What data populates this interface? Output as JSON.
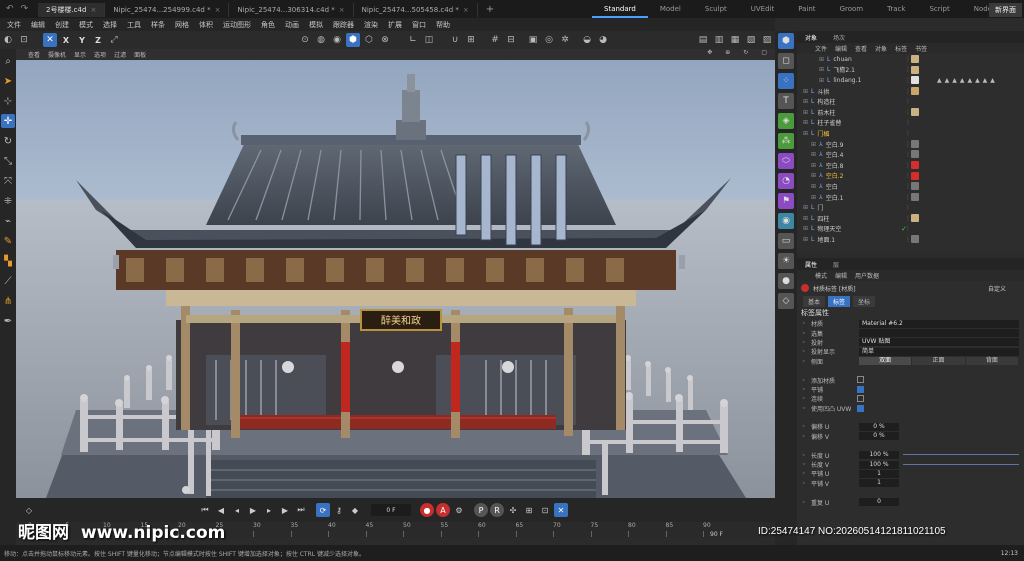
{
  "titlebar": {
    "tabs": [
      {
        "label": "2号楼楼.c4d",
        "active": true
      },
      {
        "label": "Nipic_25474...254999.c4d *",
        "active": false
      },
      {
        "label": "Nipic_25474...306314.c4d *",
        "active": false
      },
      {
        "label": "Nipic_25474...505458.c4d *",
        "active": false
      }
    ],
    "add_tab": "+",
    "layouts": [
      "Standard",
      "Model",
      "Sculpt",
      "UVEdit",
      "Paint",
      "Groom",
      "Track",
      "Script",
      "Nodes"
    ],
    "active_layout": "Standard",
    "new_layout": "新界面"
  },
  "menubar": {
    "items": [
      "文件",
      "编辑",
      "创建",
      "模式",
      "选择",
      "工具",
      "样条",
      "网格",
      "体积",
      "运动图形",
      "角色",
      "动画",
      "模拟",
      "跟踪器",
      "渲染",
      "扩展",
      "窗口",
      "帮助"
    ]
  },
  "toolbar": {
    "axes": [
      "X",
      "Y",
      "Z"
    ]
  },
  "viewport": {
    "menu": [
      "查看",
      "摄像机",
      "显示",
      "选项",
      "过滤",
      "面板"
    ],
    "plaque_text": "醉美和政"
  },
  "timeline": {
    "current_frame": "0 F",
    "end_frame": "90 F",
    "ticks": [
      "0",
      "5",
      "10",
      "15",
      "20",
      "25",
      "30",
      "35",
      "40",
      "45",
      "50",
      "55",
      "60",
      "65",
      "70",
      "75",
      "80",
      "85",
      "90"
    ]
  },
  "status": {
    "message": "移动：点击并拖动鼠标移动元素。按住 SHIFT 键量化移动；节点编辑模式时按住 SHIFT 键增加选择对象；按住 CTRL 键减少选择对象。",
    "clock": "12:13"
  },
  "objects": {
    "tabs": [
      "对象",
      "场次"
    ],
    "menu": [
      "文件",
      "编辑",
      "查看",
      "对象",
      "标签",
      "书签"
    ],
    "rows": [
      {
        "name": "chuan",
        "indent": 2,
        "tag": "#c9b183"
      },
      {
        "name": "飞檐2.1",
        "indent": 2,
        "tag": "#c9b183"
      },
      {
        "name": "lindang.1",
        "indent": 2,
        "tag": "#e0e0e0",
        "triangles": true
      },
      {
        "name": "斗拱",
        "indent": 0,
        "tag": "#c9a56a"
      },
      {
        "name": "构造柱",
        "indent": 0,
        "tag": ""
      },
      {
        "name": "前木柱",
        "indent": 0,
        "tag": "#c9b183"
      },
      {
        "name": "柱子雀替",
        "indent": 0,
        "tag": ""
      },
      {
        "name": "门楣",
        "indent": 0,
        "tag": "",
        "selected": true
      },
      {
        "name": "空白.9",
        "indent": 1,
        "tag": "#777"
      },
      {
        "name": "空白.4",
        "indent": 1,
        "tag": "#777"
      },
      {
        "name": "空白.8",
        "indent": 1,
        "tag": "#d52c2c"
      },
      {
        "name": "空白.2",
        "indent": 1,
        "tag": "#d52c2c",
        "selected": true
      },
      {
        "name": "空白",
        "indent": 1,
        "tag": "#777"
      },
      {
        "name": "空白.1",
        "indent": 1,
        "tag": "#777"
      },
      {
        "name": "门",
        "indent": 0,
        "tag": ""
      },
      {
        "name": "四柱",
        "indent": 0,
        "tag": "#c9b183"
      },
      {
        "name": "物理天空",
        "indent": 0,
        "tag": "",
        "check": true
      },
      {
        "name": "地面.1",
        "indent": 0,
        "tag": "#777"
      }
    ]
  },
  "attributes": {
    "tabs": [
      "属性",
      "层"
    ],
    "menu": [
      "模式",
      "编辑",
      "用户数据"
    ],
    "object_label": "材质标签 [材质]",
    "custom_label": "自定义",
    "chips": [
      "基本",
      "标签",
      "坐标"
    ],
    "active_chip": "标签",
    "section_title": "标签属性",
    "rows": [
      {
        "label": "材质",
        "type": "value",
        "value": "Material #6.2"
      },
      {
        "label": "选集",
        "type": "value",
        "value": ""
      },
      {
        "label": "投射",
        "type": "value",
        "value": "UVW 贴图"
      },
      {
        "label": "投射显示",
        "type": "value",
        "value": "简单"
      },
      {
        "label": "侧面",
        "type": "seg",
        "options": [
          "双面",
          "正面",
          "背面"
        ],
        "selected": "双面"
      },
      {
        "label": "",
        "type": "blank"
      },
      {
        "label": "添加材质",
        "type": "check",
        "on": false
      },
      {
        "label": "平铺",
        "type": "check",
        "on": true
      },
      {
        "label": "连续",
        "type": "check",
        "on": false
      },
      {
        "label": "使用凹凸 UVW",
        "type": "check",
        "on": true
      },
      {
        "label": "",
        "type": "blank"
      },
      {
        "label": "偏移 U",
        "type": "num",
        "value": "0 %"
      },
      {
        "label": "偏移 V",
        "type": "num",
        "value": "0 %"
      },
      {
        "label": "",
        "type": "blank"
      },
      {
        "label": "长度 U",
        "type": "num",
        "value": "100 %",
        "slider": true
      },
      {
        "label": "长度 V",
        "type": "num",
        "value": "100 %",
        "slider": true
      },
      {
        "label": "平铺 U",
        "type": "num",
        "value": "1"
      },
      {
        "label": "平铺 V",
        "type": "num",
        "value": "1"
      },
      {
        "label": "",
        "type": "blank"
      },
      {
        "label": "重复 U",
        "type": "num",
        "value": "0"
      }
    ]
  },
  "watermark": {
    "logo": "昵图网",
    "url": "www.nipic.com",
    "id_line": "ID:25474147 NO:20260514121811021105"
  }
}
